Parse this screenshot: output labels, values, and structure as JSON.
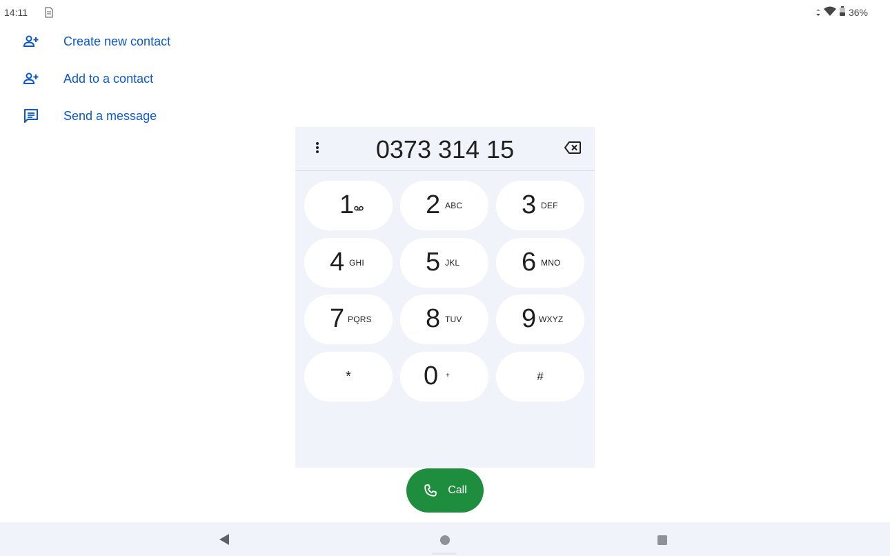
{
  "status_bar": {
    "time": "14:11",
    "battery_percent": "36%",
    "icons": [
      "sim-icon",
      "wifi-icon",
      "battery-icon"
    ]
  },
  "actions": [
    {
      "label": "Create new contact",
      "icon": "add-person-icon"
    },
    {
      "label": "Add to a contact",
      "icon": "add-person-icon"
    },
    {
      "label": "Send a message",
      "icon": "message-icon"
    }
  ],
  "dialpad": {
    "number": "0373 314 15",
    "keys": [
      {
        "digit": "1",
        "letters": ""
      },
      {
        "digit": "2",
        "letters": "ABC"
      },
      {
        "digit": "3",
        "letters": "DEF"
      },
      {
        "digit": "4",
        "letters": "GHI"
      },
      {
        "digit": "5",
        "letters": "JKL"
      },
      {
        "digit": "6",
        "letters": "MNO"
      },
      {
        "digit": "7",
        "letters": "PQRS"
      },
      {
        "digit": "8",
        "letters": "TUV"
      },
      {
        "digit": "9",
        "letters": "WXYZ"
      },
      {
        "digit": "*",
        "letters": ""
      },
      {
        "digit": "0",
        "letters": "+"
      },
      {
        "digit": "#",
        "letters": ""
      }
    ]
  },
  "call_button": {
    "label": "Call"
  },
  "colors": {
    "accent_blue": "#0b57d0",
    "call_green": "#1e8e3e",
    "dialpad_bg": "#f0f4fa"
  }
}
